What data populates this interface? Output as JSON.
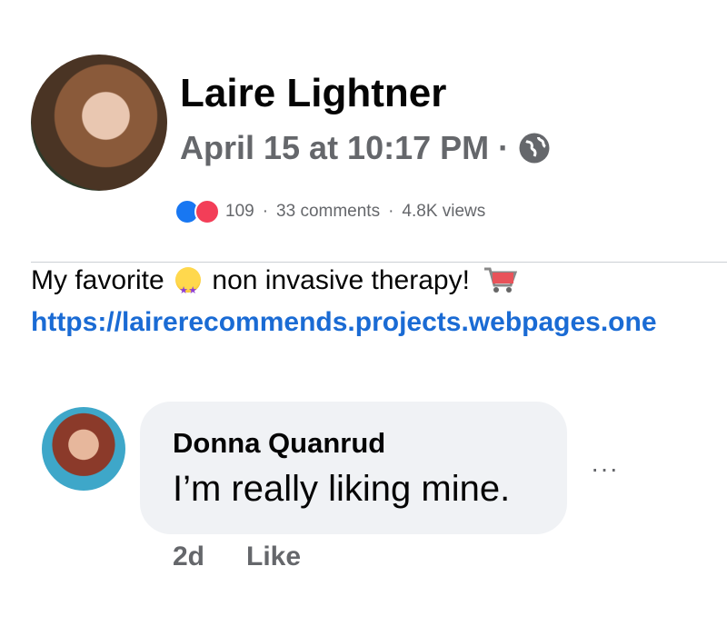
{
  "post": {
    "author": "Laire Lightner",
    "timestamp": "April 15 at 10:17 PM",
    "meta_separator": "·",
    "audience_icon": "globe-icon",
    "reactions": {
      "icons": [
        "like-icon",
        "love-icon"
      ],
      "count": "109",
      "comments": "33 comments",
      "views": "4.8K views",
      "separator": "·"
    },
    "text_before_emoji": "My favorite",
    "text_after_emoji": "non invasive therapy!",
    "emoji_icon": "star-struck-emoji-icon",
    "trailing_icon": "shopping-cart-icon",
    "link": "https://lairerecommends.projects.webpages.one"
  },
  "comment": {
    "author": "Donna Quanrud",
    "text": "I’m really liking mine.",
    "time": "2d",
    "like_label": "Like",
    "more_label": "···"
  },
  "colors": {
    "link": "#1a6bd4",
    "muted": "#65676b",
    "bubble": "#f0f2f5",
    "like": "#1877f2",
    "love": "#f33e58"
  }
}
